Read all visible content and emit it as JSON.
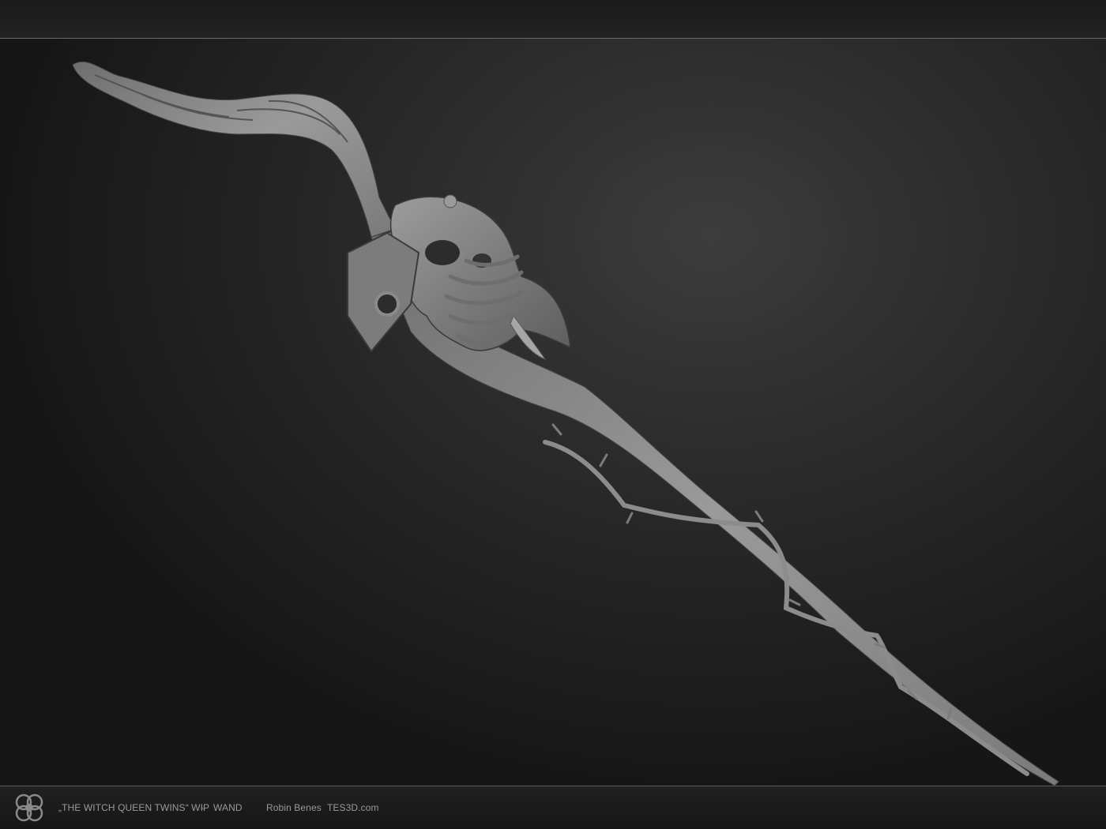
{
  "caption": {
    "title": "„THE WITCH QUEEN TWINS“ WIP",
    "separator": "-",
    "item": "WAND",
    "author": "Robin Benes",
    "site": "TES3D.com"
  },
  "icons": {
    "logo": "tes3d-logo-icon"
  },
  "colors": {
    "background": "#1b1b1b",
    "wand": "#8a8a8a",
    "caption_text": "#9a9a9a"
  }
}
